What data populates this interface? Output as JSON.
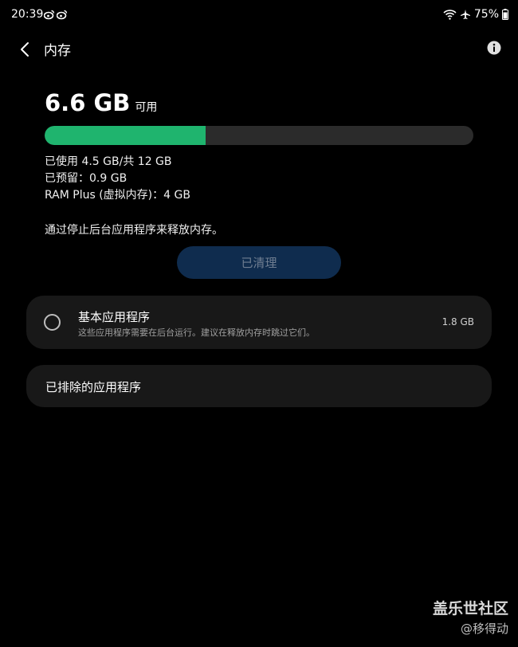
{
  "status_bar": {
    "time": "20:39",
    "battery": "75%",
    "icons": [
      "weibo-icon",
      "weibo-icon",
      "wifi-icon",
      "airplane-icon",
      "battery-icon"
    ]
  },
  "header": {
    "title": "内存",
    "back_icon": "chevron-left-icon",
    "info_icon": "info-icon"
  },
  "summary": {
    "available_value": "6.6 GB",
    "available_suffix": "可用",
    "used_fraction": 0.375,
    "used_color": "#1fb46e",
    "used_line": "已使用 4.5 GB/共 12 GB",
    "reserved_line": "已预留：0.9 GB",
    "ram_plus_line": "RAM Plus (虚拟内存)：4 GB"
  },
  "hint": "通过停止后台应用程序来释放内存。",
  "clean_button": {
    "label": "已清理"
  },
  "basic_apps": {
    "title": "基本应用程序",
    "subtitle": "这些应用程序需要在后台运行。建议在释放内存时跳过它们。",
    "size": "1.8 GB"
  },
  "excluded_apps": {
    "title": "已排除的应用程序"
  },
  "watermark": {
    "main": "盖乐世社区",
    "sub": "@移得动"
  }
}
